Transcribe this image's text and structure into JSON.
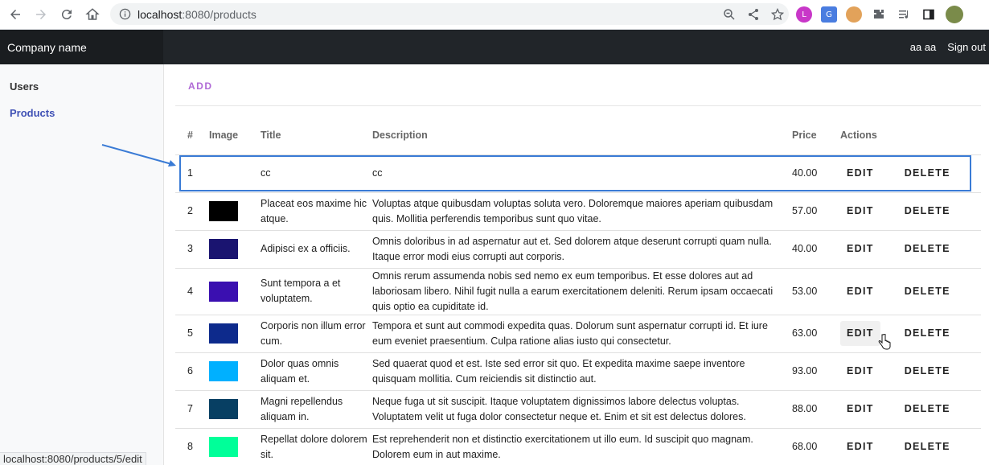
{
  "browser": {
    "url_host": "localhost",
    "url_rest": ":8080/products",
    "status_url": "localhost:8080/products/5/edit"
  },
  "appbar": {
    "brand": "Company name",
    "user": "aa aa",
    "signout": "Sign out"
  },
  "sidebar": {
    "items": [
      {
        "label": "Users"
      },
      {
        "label": "Products"
      }
    ]
  },
  "main": {
    "add_label": "ADD",
    "columns": [
      "#",
      "Image",
      "Title",
      "Description",
      "Price",
      "Actions"
    ],
    "edit_label": "EDIT",
    "delete_label": "DELETE",
    "rows": [
      {
        "num": "1",
        "image_color": "",
        "title": "cc",
        "description": "cc",
        "price": "40.00"
      },
      {
        "num": "2",
        "image_color": "#000000",
        "title": "Placeat eos maxime hic atque.",
        "description": "Voluptas atque quibusdam voluptas soluta vero. Doloremque maiores aperiam quibusdam quis. Mollitia perferendis temporibus sunt quo vitae.",
        "price": "57.00"
      },
      {
        "num": "3",
        "image_color": "#1a1470",
        "title": "Adipisci ex a officiis.",
        "description": "Omnis doloribus in ad aspernatur aut et. Sed dolorem atque deserunt corrupti quam nulla. Itaque error modi eius corrupti aut corporis.",
        "price": "40.00"
      },
      {
        "num": "4",
        "image_color": "#3a0fb0",
        "title": "Sunt tempora a et voluptatem.",
        "description": "Omnis rerum assumenda nobis sed nemo ex eum temporibus. Et esse dolores aut ad laboriosam libero. Nihil fugit nulla a earum exercitationem deleniti. Rerum ipsam occaecati quis optio ea cupiditate id.",
        "price": "53.00"
      },
      {
        "num": "5",
        "image_color": "#0d2a8c",
        "title": "Corporis non illum error cum.",
        "description": "Tempora et sunt aut commodi expedita quas. Dolorum sunt aspernatur corrupti id. Et iure eum eveniet praesentium. Culpa ratione alias iusto qui consectetur.",
        "price": "63.00"
      },
      {
        "num": "6",
        "image_color": "#00b0ff",
        "title": "Dolor quas omnis aliquam et.",
        "description": "Sed quaerat quod et est. Iste sed error sit quo. Et expedita maxime saepe inventore quisquam mollitia. Cum reiciendis sit distinctio aut.",
        "price": "93.00"
      },
      {
        "num": "7",
        "image_color": "#073f63",
        "title": "Magni repellendus aliquam in.",
        "description": "Neque fuga ut sit suscipit. Itaque voluptatem dignissimos labore delectus voluptas. Voluptatem velit ut fuga dolor consectetur neque et. Enim et sit est delectus dolores.",
        "price": "88.00"
      },
      {
        "num": "8",
        "image_color": "#00ff99",
        "title": "Repellat dolore dolorem sit.",
        "description": "Est reprehenderit non et distinctio exercitationem ut illo eum. Id suscipit quo magnam. Dolorem eum in aut maxime.",
        "price": "68.00"
      }
    ]
  }
}
